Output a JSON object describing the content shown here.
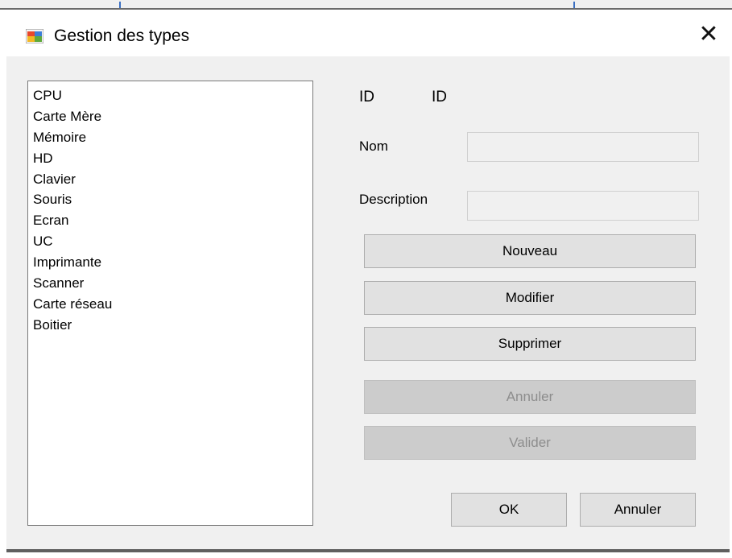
{
  "window": {
    "title": "Gestion des types",
    "icon": "winforms-app-icon",
    "close_glyph": "✕"
  },
  "list": {
    "items": [
      "CPU",
      "Carte Mère",
      "Mémoire",
      "HD",
      "Clavier",
      "Souris",
      "Ecran",
      "UC",
      "Imprimante",
      "Scanner",
      "Carte réseau",
      "Boitier"
    ]
  },
  "form": {
    "id_label": "ID",
    "id_value": "ID",
    "nom_label": "Nom",
    "nom_value": "",
    "description_label": "Description",
    "description_value": ""
  },
  "buttons": {
    "nouveau": "Nouveau",
    "modifier": "Modifier",
    "supprimer": "Supprimer",
    "annuler_edit": "Annuler",
    "valider": "Valider",
    "ok": "OK",
    "annuler": "Annuler"
  },
  "colors": {
    "dialog_bg": "#f0f0f0",
    "button_bg": "#e1e1e1",
    "disabled_button_bg": "#cccccc",
    "disabled_text": "#8d8d8d"
  }
}
